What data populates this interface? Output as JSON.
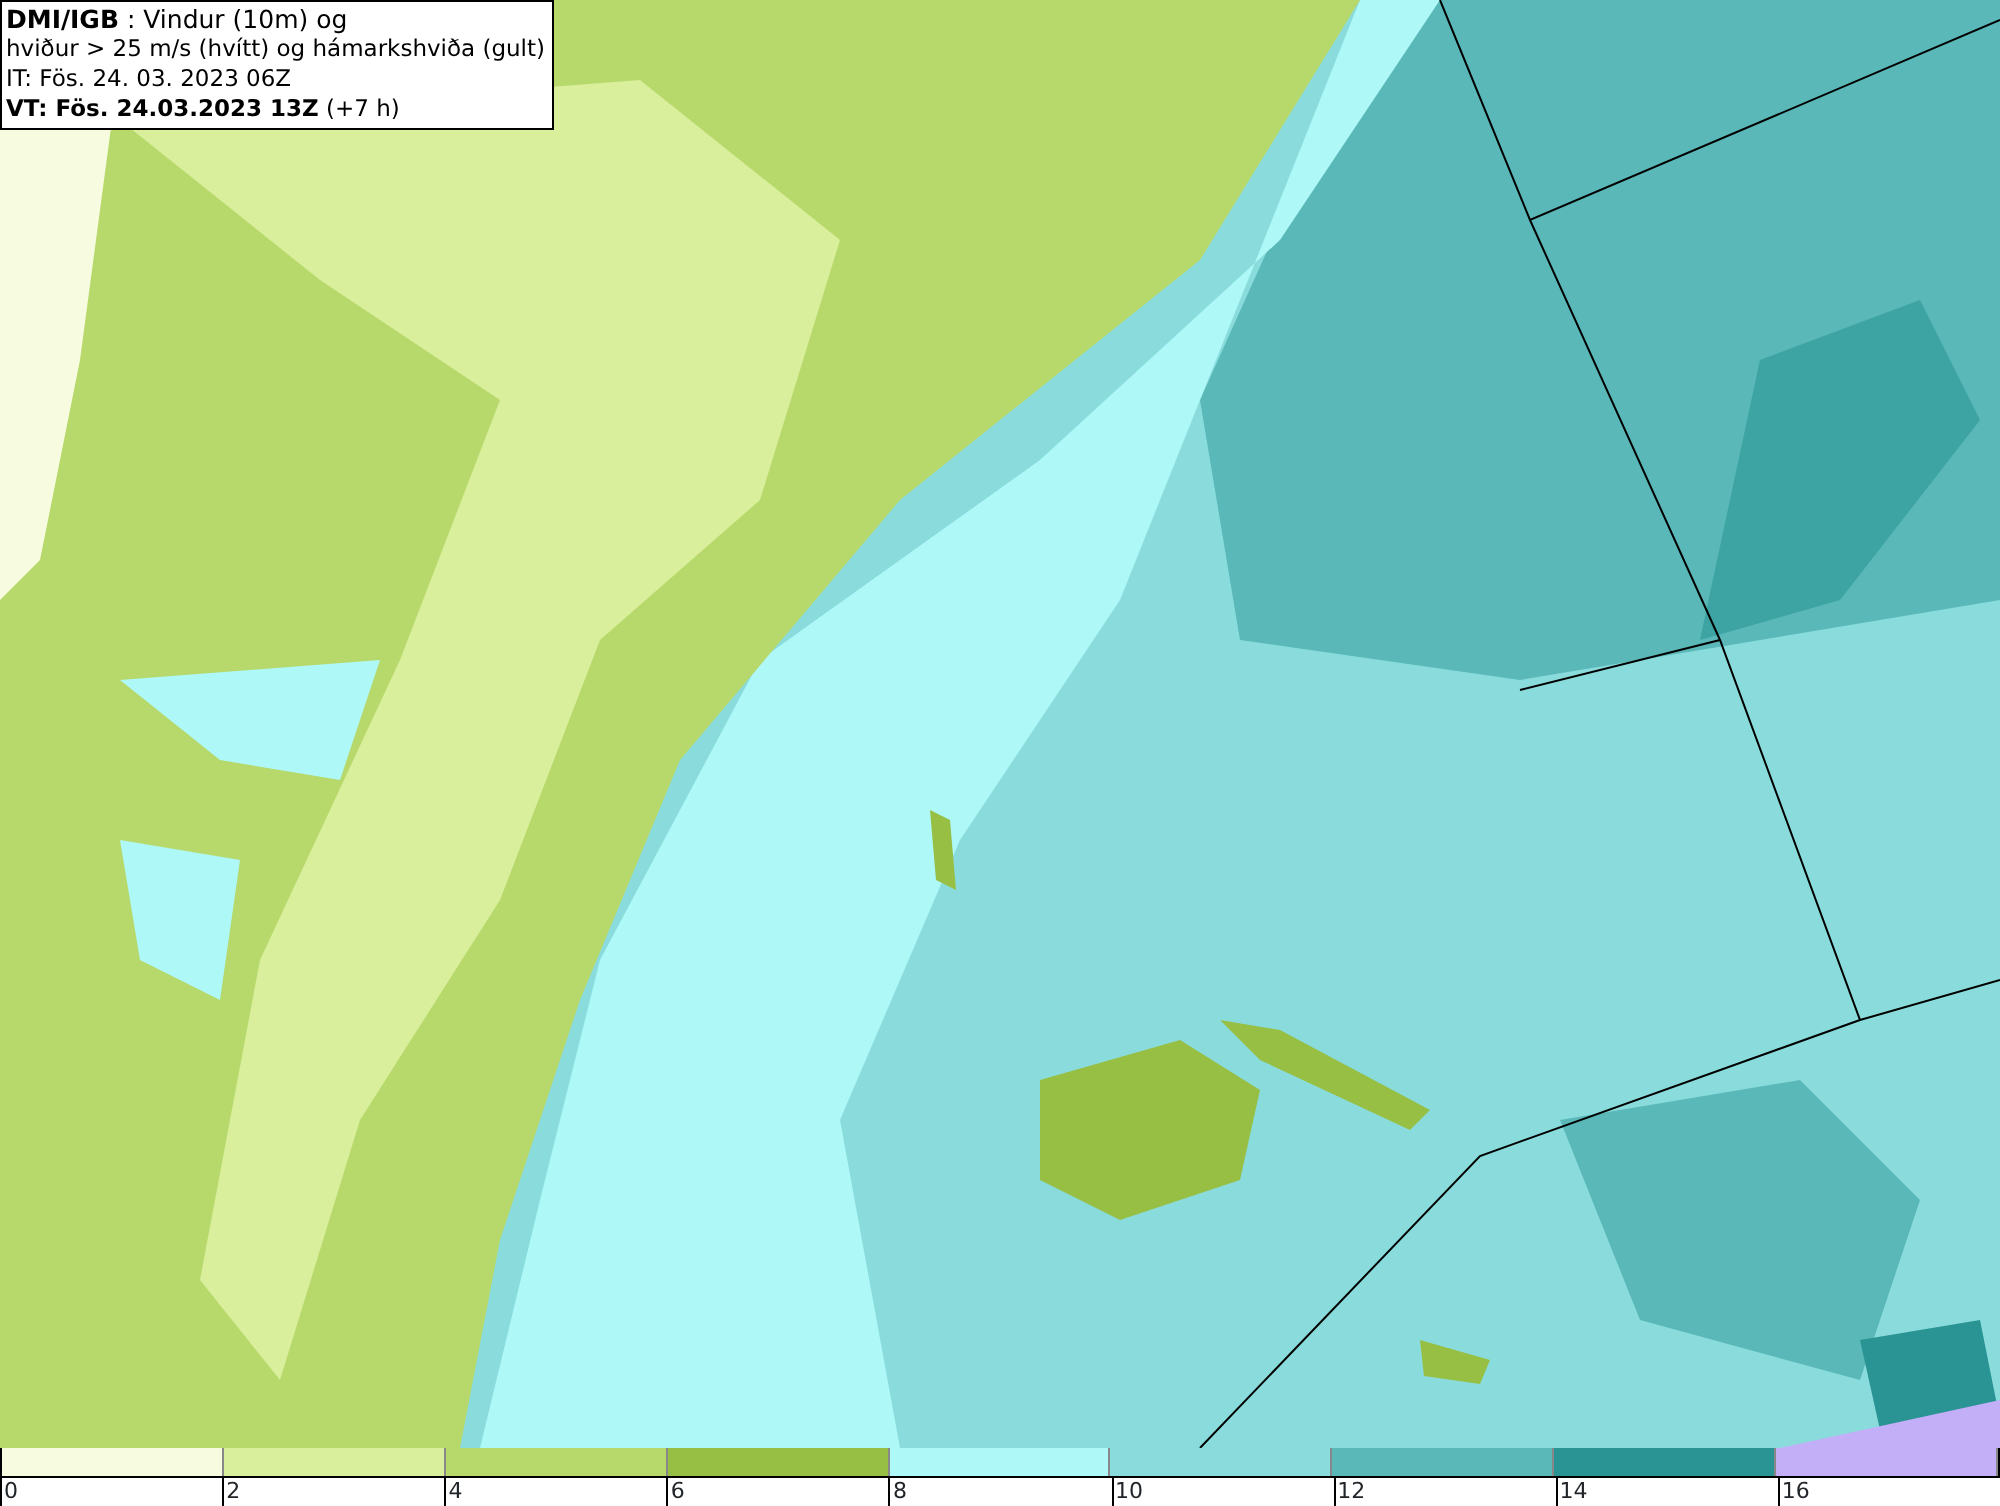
{
  "header": {
    "lines": [
      "**DMI/IGB** : Vindur (10m) og",
      "hviður > 25 m/s (hvítt) og hámarkshviða (gult)",
      "IT: Fös. 24. 03. 2023 06Z",
      "**VT: Fös. 24.03.2023 13Z** (+7 h)"
    ]
  },
  "legend": {
    "bins": [
      {
        "color": "#f7fbdf"
      },
      {
        "color": "#d9ef9c"
      },
      {
        "color": "#b7d96c"
      },
      {
        "color": "#97bf44"
      },
      {
        "color": "#aef8f8"
      },
      {
        "color": "#8adcdc"
      },
      {
        "color": "#5ab8b8"
      },
      {
        "color": "#2a9494"
      },
      {
        "color": "#c3aef8"
      }
    ],
    "ticks": [
      "0",
      "2",
      "4",
      "6",
      "8",
      "10",
      "12",
      "14",
      "16"
    ]
  }
}
